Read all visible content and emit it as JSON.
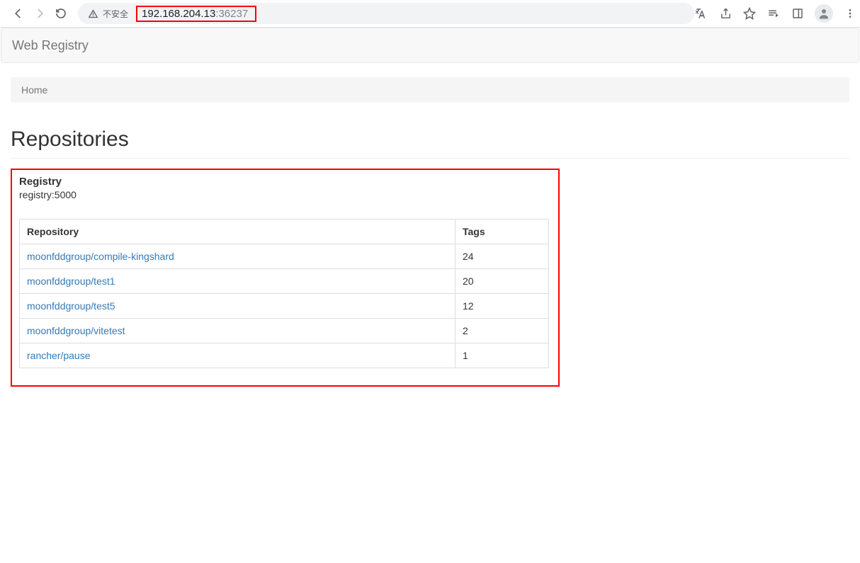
{
  "browser": {
    "security_label": "不安全",
    "url_host": "192.168.204.13",
    "url_port": ":36237"
  },
  "navbar": {
    "brand": "Web Registry"
  },
  "breadcrumb": {
    "home": "Home"
  },
  "heading": "Repositories",
  "registry_panel": {
    "label": "Registry",
    "host": "registry:5000"
  },
  "table": {
    "col_repo": "Repository",
    "col_tags": "Tags",
    "rows": [
      {
        "repo": "moonfddgroup/compile-kingshard",
        "tags": "24"
      },
      {
        "repo": "moonfddgroup/test1",
        "tags": "20"
      },
      {
        "repo": "moonfddgroup/test5",
        "tags": "12"
      },
      {
        "repo": "moonfddgroup/vitetest",
        "tags": "2"
      },
      {
        "repo": "rancher/pause",
        "tags": "1"
      }
    ]
  }
}
